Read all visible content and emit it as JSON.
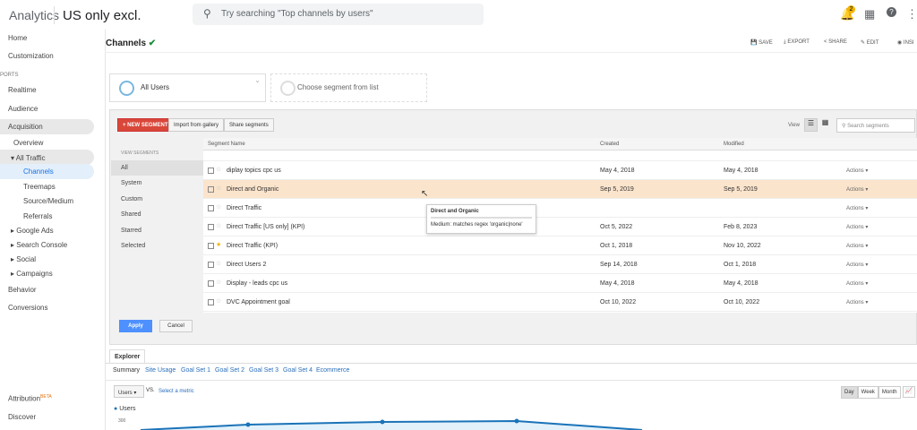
{
  "topbar": {
    "brand": "Analytics",
    "property": "US only excl.",
    "search_placeholder": "Try searching \"Top channels by users\"",
    "notifications": "2"
  },
  "sidebar": {
    "items": [
      "Home",
      "Customization",
      "PORTS",
      "Realtime",
      "Audience",
      "Acquisition",
      "Overview",
      "All Traffic",
      "Channels",
      "Treemaps",
      "Source/Medium",
      "Referrals",
      "Google Ads",
      "Search Console",
      "Social",
      "Campaigns",
      "Behavior",
      "Conversions"
    ],
    "attribution": "Attribution",
    "beta": "BETA",
    "discover": "Discover"
  },
  "header": {
    "title": "Channels",
    "actions": [
      "SAVE",
      "EXPORT",
      "SHARE",
      "EDIT",
      "INSI"
    ]
  },
  "segments": {
    "selected": "All Users",
    "choose": "Choose segment from list"
  },
  "picker": {
    "new_segment": "+ NEW SEGMENT",
    "import": "Import from gallery",
    "share": "Share segments",
    "view_label": "View",
    "search_placeholder": "Search segments",
    "view_heading": "VIEW SEGMENTS",
    "views": [
      "All",
      "System",
      "Custom",
      "Shared",
      "Starred",
      "Selected"
    ],
    "columns": [
      "Segment Name",
      "Created",
      "Modified"
    ],
    "rows": [
      {
        "name": "diplay topics cpc us",
        "created": "May 4, 2018",
        "modified": "May 4, 2018",
        "actions": "Actions"
      },
      {
        "name": "Direct and Organic",
        "created": "Sep 5, 2019",
        "modified": "Sep 5, 2019",
        "actions": "Actions"
      },
      {
        "name": "Direct Traffic",
        "created": "",
        "modified": "",
        "actions": "Actions"
      },
      {
        "name": "Direct Traffic [US only] (KPI)",
        "created": "Oct 5, 2022",
        "modified": "Feb 8, 2023",
        "actions": "Actions"
      },
      {
        "name": "Direct Traffic (KPI)",
        "created": "Oct 1, 2018",
        "modified": "Nov 10, 2022",
        "actions": "Actions"
      },
      {
        "name": "Direct Users 2",
        "created": "Sep 14, 2018",
        "modified": "Oct 1, 2018",
        "actions": "Actions"
      },
      {
        "name": "Display - leads cpc us",
        "created": "May 4, 2018",
        "modified": "May 4, 2018",
        "actions": "Actions"
      },
      {
        "name": "DVC Appointment goal",
        "created": "Oct 10, 2022",
        "modified": "Oct 10, 2022",
        "actions": "Actions"
      }
    ],
    "tooltip": {
      "title": "Direct and Organic",
      "body": "Medium: matches regex 'organic|none'"
    },
    "apply": "Apply",
    "cancel": "Cancel"
  },
  "explorer": {
    "tab": "Explorer",
    "subtabs": [
      "Summary",
      "Site Usage",
      "Goal Set 1",
      "Goal Set 2",
      "Goal Set 3",
      "Goal Set 4",
      "Ecommerce"
    ],
    "metric": "Users",
    "vs": "VS.",
    "select_metric": "Select a metric",
    "legend": "Users",
    "ytick": "300",
    "ranges": [
      "Day",
      "Week",
      "Month"
    ]
  }
}
